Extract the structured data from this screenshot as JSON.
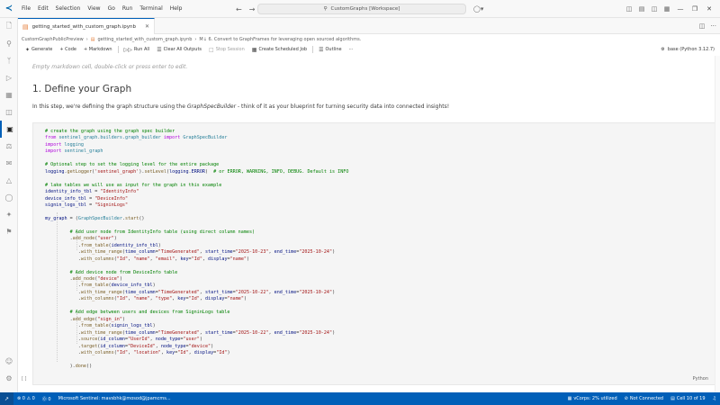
{
  "titlebar": {
    "menu": [
      "File",
      "Edit",
      "Selection",
      "View",
      "Go",
      "Run",
      "Terminal",
      "Help"
    ],
    "command_center": "CustomGraphs [Workspace]"
  },
  "tab": {
    "label": "getting_started_with_custom_graph.ipynb"
  },
  "breadcrumb": {
    "items": [
      "CustomGraphPublicPreview",
      "getting_started_with_custom_graph.ipynb",
      "M↓ 6. Convert to GraphFrames for leveraging open sourced algorithms."
    ]
  },
  "toolbar": {
    "generate": "Generate",
    "code": "+ Code",
    "markdown": "+ Markdown",
    "run_all": "Run All",
    "clear_outputs": "Clear All Outputs",
    "stop_session": "Stop Session",
    "create_job": "Create Scheduled Job",
    "outline": "Outline",
    "more": "···",
    "kernel": "base (Python 3.12.7)"
  },
  "editor": {
    "empty_markdown": "Empty markdown cell, double-click or press enter to edit.",
    "heading": "1. Define your Graph",
    "para_before": "In this step, we're defining the graph structure using the ",
    "para_em": "GraphSpecBuilder",
    "para_after": " - think of it as your blueprint for turning security data into connected insights!",
    "cell_language": "Python",
    "gutter": "[ ]"
  },
  "statusbar": {
    "branch": "⊗ 0 ⚠ 0",
    "ports": "⓪ 0",
    "account": "Microsoft Sentinel: mavsbhk@mosod@jpamcms...",
    "spaces": "vCorps: 2% utilized",
    "connection": "Not Connected",
    "cell": "Cell 10 of 19"
  },
  "icons": {
    "logo": "vscode-logo-icon",
    "explorer": "files-icon",
    "search": "search-icon",
    "source_control": "source-control-icon",
    "run_debug": "run-debug-icon",
    "extensions": "extensions-icon"
  },
  "colors": {
    "accent": "#005fb8",
    "statusbar": "#005fb8"
  }
}
